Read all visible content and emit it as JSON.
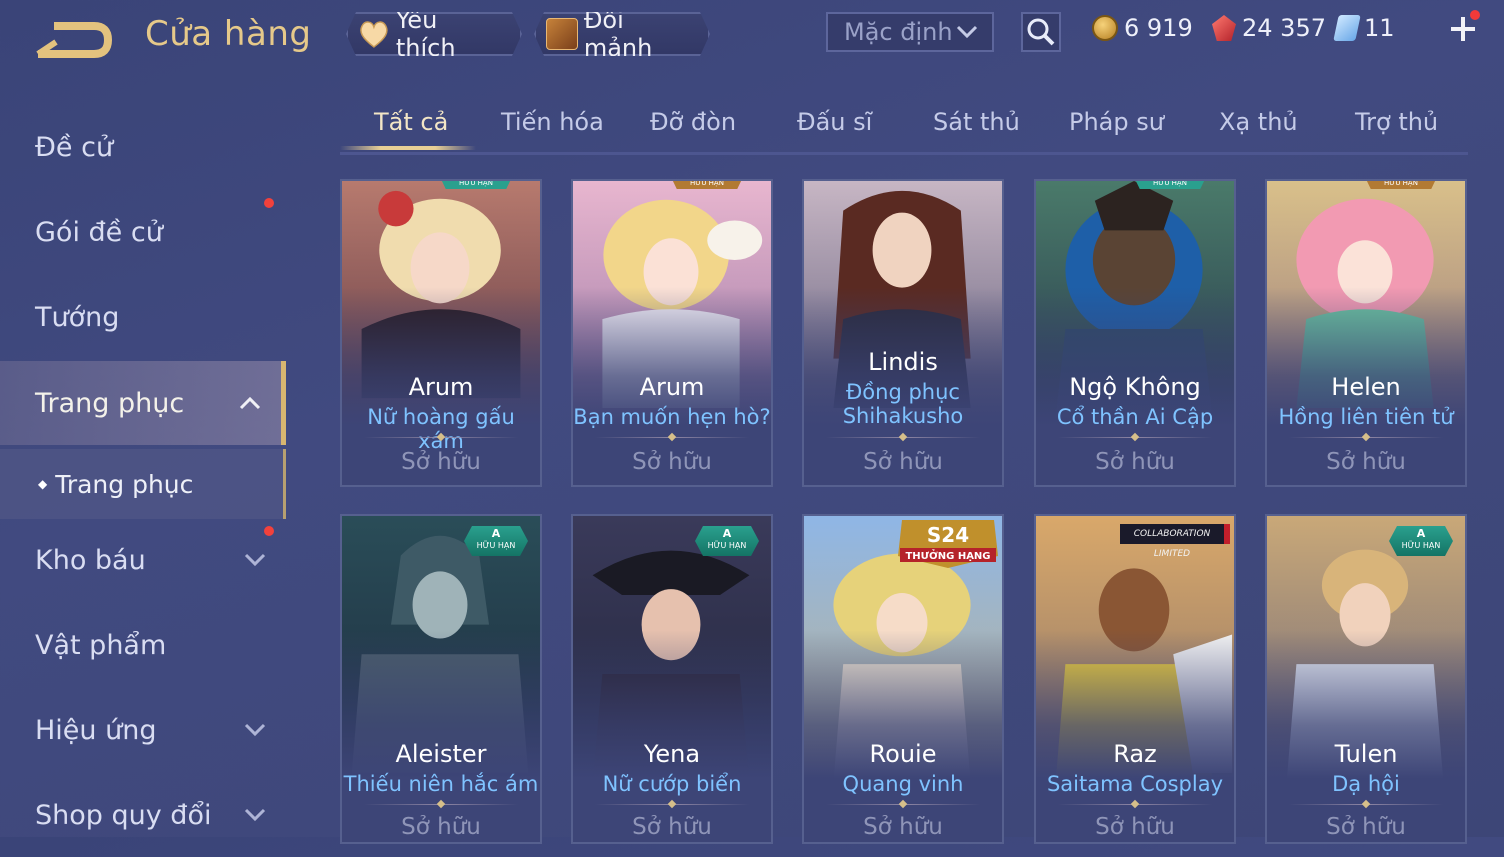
{
  "header": {
    "title": "Cửa hàng",
    "favorites_label": "Yêu thích",
    "exchange_label": "Đổi mảnh",
    "sort_value": "Mặc định",
    "gold": "6 919",
    "rubies": "24 357",
    "vouchers": "11"
  },
  "sidebar": {
    "items": [
      {
        "label": "Đề cử"
      },
      {
        "label": "Gói đề cử"
      },
      {
        "label": "Tướng"
      },
      {
        "label": "Trang phục"
      },
      {
        "label": "Kho báu"
      },
      {
        "label": "Vật phẩm"
      },
      {
        "label": "Hiệu ứng"
      },
      {
        "label": "Shop quy đổi"
      }
    ],
    "sub_item": "Trang phục"
  },
  "tabs": [
    "Tất cả",
    "Tiến hóa",
    "Đỡ đòn",
    "Đấu sĩ",
    "Sát thủ",
    "Pháp sư",
    "Xạ thủ",
    "Trợ thủ"
  ],
  "badges": {
    "limited": "HỮU HẠN",
    "grade": "A",
    "s24": "S24",
    "rank_reward": "THƯỞNG HẠNG",
    "collab": "COLLABORATION LIMITED"
  },
  "cards": [
    {
      "hero": "Arum",
      "skin": "Nữ hoàng gấu xám",
      "status": "Sở hữu"
    },
    {
      "hero": "Arum",
      "skin": "Bạn muốn hẹn hò?",
      "status": "Sở hữu"
    },
    {
      "hero": "Lindis",
      "skin": "Đồng phục Shihakusho",
      "skin_line1": "Đồng phục",
      "skin_line2": "Shihakusho",
      "status": "Sở hữu"
    },
    {
      "hero": "Ngộ Không",
      "skin": "Cổ thần Ai Cập",
      "status": "Sở hữu"
    },
    {
      "hero": "Helen",
      "skin": "Hồng liên tiên tử",
      "status": "Sở hữu"
    },
    {
      "hero": "Aleister",
      "skin": "Thiếu niên hắc ám",
      "status": "Sở hữu"
    },
    {
      "hero": "Yena",
      "skin": "Nữ cướp biển",
      "status": "Sở hữu"
    },
    {
      "hero": "Rouie",
      "skin": "Quang vinh",
      "status": "Sở hữu"
    },
    {
      "hero": "Raz",
      "skin": "Saitama Cosplay",
      "status": "Sở hữu"
    },
    {
      "hero": "Tulen",
      "skin": "Dạ hội",
      "status": "Sở hữu"
    }
  ],
  "colors": {
    "background": "#3d4677",
    "title_gold": "#e6c98a",
    "skin_name_blue": "#7fc3ff",
    "notification_red": "#f2413c",
    "active_accent": "#d8b670"
  }
}
